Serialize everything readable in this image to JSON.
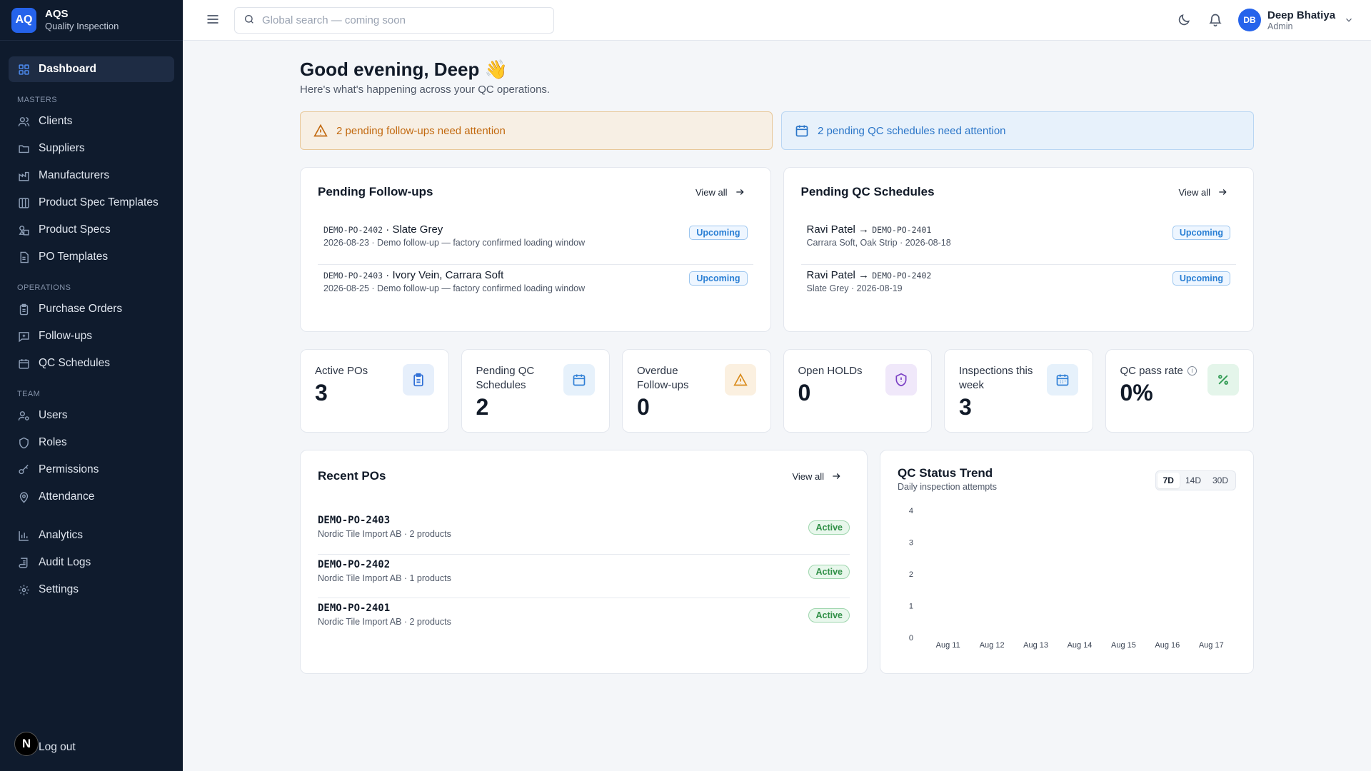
{
  "brand": {
    "logo": "AQ",
    "name": "AQS",
    "subtitle": "Quality Inspection"
  },
  "sidebar": {
    "dashboard": "Dashboard",
    "sections": {
      "masters": "MASTERS",
      "operations": "OPERATIONS",
      "team": "TEAM"
    },
    "masters": [
      "Clients",
      "Suppliers",
      "Manufacturers",
      "Product Spec Templates",
      "Product Specs",
      "PO Templates"
    ],
    "operations": [
      "Purchase Orders",
      "Follow-ups",
      "QC Schedules"
    ],
    "team": [
      "Users",
      "Roles",
      "Permissions",
      "Attendance"
    ],
    "other": [
      "Analytics",
      "Audit Logs",
      "Settings"
    ],
    "logout": "Log out",
    "n_badge": "N"
  },
  "topbar": {
    "search_placeholder": "Global search — coming soon",
    "user": {
      "initials": "DB",
      "name": "Deep Bhatiya",
      "role": "Admin"
    }
  },
  "greeting": {
    "title": "Good evening, Deep 👋",
    "subtitle": "Here's what's happening across your QC operations."
  },
  "alerts": {
    "followups": "2 pending follow-ups need attention",
    "schedules": "2 pending QC schedules need attention"
  },
  "pending_followups": {
    "title": "Pending Follow-ups",
    "view_all": "View all",
    "items": [
      {
        "code": "DEMO-PO-2402",
        "name": "Slate Grey",
        "detail": "2026-08-23 · Demo follow-up — factory confirmed loading window",
        "status": "Upcoming"
      },
      {
        "code": "DEMO-PO-2403",
        "name": "Ivory Vein, Carrara Soft",
        "detail": "2026-08-25 · Demo follow-up — factory confirmed loading window",
        "status": "Upcoming"
      }
    ]
  },
  "pending_schedules": {
    "title": "Pending QC Schedules",
    "view_all": "View all",
    "items": [
      {
        "person": "Ravi Patel",
        "arrow": "→",
        "code": "DEMO-PO-2401",
        "detail": "Carrara Soft, Oak Strip · 2026-08-18",
        "status": "Upcoming"
      },
      {
        "person": "Ravi Patel",
        "arrow": "→",
        "code": "DEMO-PO-2402",
        "detail": "Slate Grey · 2026-08-19",
        "status": "Upcoming"
      }
    ]
  },
  "stats": [
    {
      "label": "Active POs",
      "value": "3",
      "icon": "clipboard-icon",
      "color": "#2f6fd6",
      "bg": "#e6effb"
    },
    {
      "label": "Pending QC Schedules",
      "value": "2",
      "icon": "calendar-icon",
      "color": "#2f7fd6",
      "bg": "#e6f1fb"
    },
    {
      "label": "Overdue Follow-ups",
      "value": "0",
      "icon": "warning-icon",
      "color": "#d98a1a",
      "bg": "#fbf0e0"
    },
    {
      "label": "Open HOLDs",
      "value": "0",
      "icon": "shield-icon",
      "color": "#7a3fc4",
      "bg": "#f0e8fa"
    },
    {
      "label": "Inspections this week",
      "value": "3",
      "icon": "calendar-grid-icon",
      "color": "#2f7fd6",
      "bg": "#e6f1fb"
    },
    {
      "label": "QC pass rate",
      "value": "0%",
      "icon": "percent-icon",
      "color": "#2f9a52",
      "bg": "#e4f5ea",
      "info": "i"
    }
  ],
  "recent_pos": {
    "title": "Recent POs",
    "view_all": "View all",
    "items": [
      {
        "code": "DEMO-PO-2403",
        "detail": "Nordic Tile Import AB · 2 products",
        "status": "Active"
      },
      {
        "code": "DEMO-PO-2402",
        "detail": "Nordic Tile Import AB · 1 products",
        "status": "Active"
      },
      {
        "code": "DEMO-PO-2401",
        "detail": "Nordic Tile Import AB · 2 products",
        "status": "Active"
      }
    ]
  },
  "qc_trend": {
    "title": "QC Status Trend",
    "subtitle": "Daily inspection attempts",
    "ranges": [
      "7D",
      "14D",
      "30D"
    ],
    "selected_range": "7D"
  },
  "chart_data": {
    "type": "line",
    "title": "QC Status Trend",
    "subtitle": "Daily inspection attempts",
    "categories": [
      "Aug 11",
      "Aug 12",
      "Aug 13",
      "Aug 14",
      "Aug 15",
      "Aug 16",
      "Aug 17"
    ],
    "series": [],
    "yticks": [
      0,
      1,
      2,
      3,
      4
    ],
    "ylim": [
      0,
      4
    ],
    "grid": false
  }
}
